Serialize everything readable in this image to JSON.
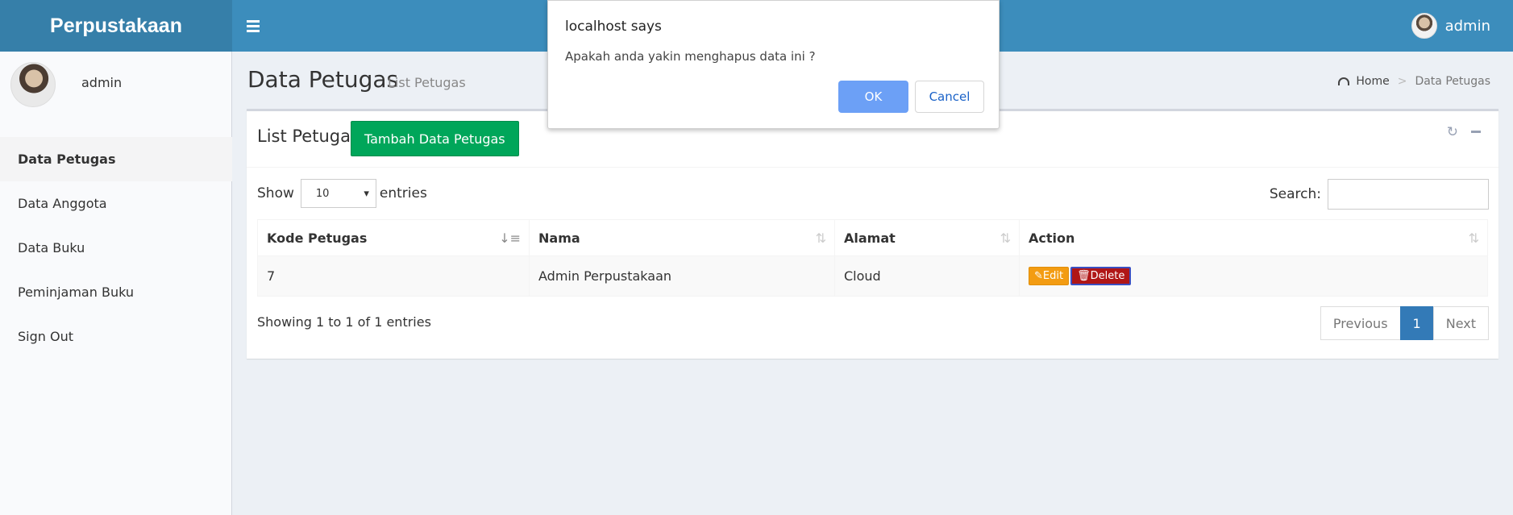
{
  "header": {
    "logo": "Perpustakaan",
    "user": "admin"
  },
  "sidebar": {
    "user_name": "admin",
    "items": [
      {
        "label": "Data Petugas"
      },
      {
        "label": "Data Anggota"
      },
      {
        "label": "Data Buku"
      },
      {
        "label": "Peminjaman Buku"
      },
      {
        "label": "Sign Out"
      }
    ]
  },
  "content": {
    "title": "Data Petugas",
    "subtitle": "List Petugas",
    "breadcrumb": {
      "home": "Home",
      "sep": ">",
      "current": "Data Petugas"
    }
  },
  "box": {
    "title": "List Petugas",
    "add_button": "Tambah Data Petugas",
    "show_label": "Show",
    "entries_label": "entries",
    "page_size": "10",
    "search_label": "Search:",
    "search_value": ""
  },
  "table": {
    "headers": [
      "Kode Petugas",
      "Nama",
      "Alamat",
      "Action"
    ],
    "rows": [
      {
        "kode": "7",
        "nama": "Admin Perpustakaan",
        "alamat": "Cloud",
        "edit": "Edit",
        "delete": "Delete"
      }
    ]
  },
  "footer": {
    "info": "Showing 1 to 1 of 1 entries",
    "previous": "Previous",
    "page": "1",
    "next": "Next"
  },
  "dialog": {
    "title": "localhost says",
    "message": "Apakah anda yakin menghapus data ini ?",
    "ok": "OK",
    "cancel": "Cancel"
  }
}
